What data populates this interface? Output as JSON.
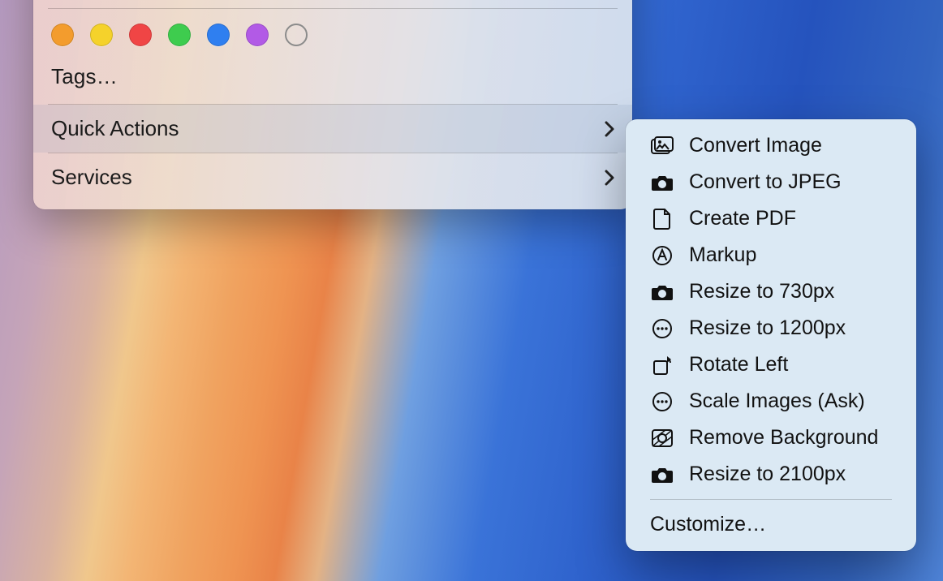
{
  "contextMenu": {
    "tagsLabel": "Tags…",
    "tagColors": [
      "#f39c2d",
      "#f5d22b",
      "#f04545",
      "#3ecc4e",
      "#2f7ff0",
      "#b25ae6"
    ],
    "items": [
      {
        "label": "Quick Actions",
        "hasSubmenu": true,
        "highlighted": true
      },
      {
        "label": "Services",
        "hasSubmenu": true,
        "highlighted": false
      }
    ]
  },
  "submenu": {
    "items": [
      {
        "icon": "picture-icon",
        "label": "Convert Image"
      },
      {
        "icon": "camera-icon",
        "label": "Convert to JPEG"
      },
      {
        "icon": "document-icon",
        "label": "Create PDF"
      },
      {
        "icon": "markup-icon",
        "label": "Markup"
      },
      {
        "icon": "camera-icon",
        "label": "Resize to 730px"
      },
      {
        "icon": "ellipsis-circle-icon",
        "label": "Resize to 1200px"
      },
      {
        "icon": "rotate-left-icon",
        "label": "Rotate Left"
      },
      {
        "icon": "ellipsis-circle-icon",
        "label": "Scale Images (Ask)"
      },
      {
        "icon": "remove-bg-icon",
        "label": "Remove Background"
      },
      {
        "icon": "camera-icon",
        "label": "Resize to 2100px"
      }
    ],
    "customizeLabel": "Customize…"
  }
}
